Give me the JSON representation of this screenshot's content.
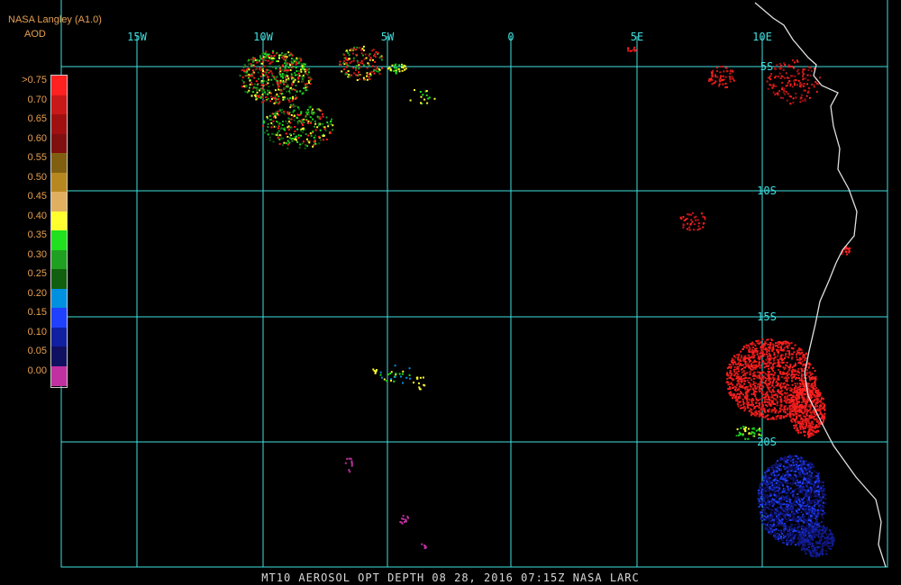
{
  "header": {
    "source": "NASA Langley (A1.0)",
    "product": "AOD"
  },
  "legend": {
    "labels": [
      ">0.75",
      "0.70",
      "0.65",
      "0.60",
      "0.55",
      "0.50",
      "0.45",
      "0.40",
      "0.35",
      "0.30",
      "0.25",
      "0.20",
      "0.15",
      "0.10",
      "0.05",
      "0.00"
    ],
    "colors": [
      "#ff2020",
      "#c81818",
      "#a01010",
      "#801010",
      "#806010",
      "#b88820",
      "#e0b060",
      "#ffff30",
      "#20e020",
      "#20a020",
      "#106010",
      "#0090e0",
      "#2040ff",
      "#1020a0",
      "#101060",
      "#c030a0"
    ]
  },
  "map": {
    "lon_labels": [
      "15W",
      "10W",
      "5W",
      "0",
      "5E",
      "10E"
    ],
    "lat_labels": [
      "5S",
      "10S",
      "15S",
      "20S"
    ],
    "grid_color": "#40e0e0",
    "coast_color": "#e0e0e0"
  },
  "footer": {
    "caption": "MT10  AEROSOL OPT DEPTH   08 28, 2016 07:15Z   NASA LARC"
  }
}
